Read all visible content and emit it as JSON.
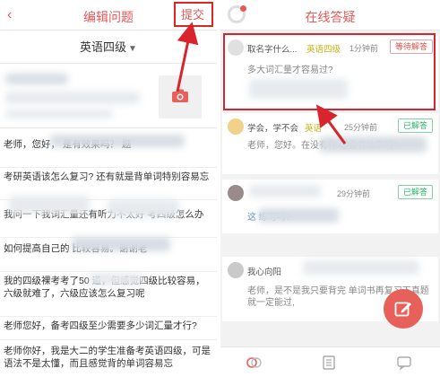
{
  "left": {
    "header": {
      "title": "编辑问题",
      "submit_label": "提交"
    },
    "subject": {
      "value": "英语四级"
    },
    "questions": [
      {
        "text": "老师，您好，     是有效果吗？   题"
      },
      {
        "text": "考研英语该怎么复习? 还有就是背单词特别容易忘"
      },
      {
        "text": "我问一下我词汇量还有听力不太好      考四级怎么办"
      },
      {
        "text": "如何提高自己的      比较容易。谢谢老"
      },
      {
        "text": "我的四级裸考考了50      道，但感觉四级比较容易，六级就难了，六级应该怎么复习呢"
      },
      {
        "text": "老师您好，备考四级至少需要多少词汇量才行?"
      },
      {
        "text": "老师你好，我是大二的学生准备考英语四级，可是语法不是太懂，而且感觉背的单词容易忘"
      }
    ]
  },
  "right": {
    "header": {
      "title": "在线答疑"
    },
    "cards": [
      {
        "user": "取名字什么...",
        "level": "英语四级",
        "time": "1分钟前",
        "status": "等待解答",
        "question": "多大词汇量才容易过?"
      },
      {
        "user": "学会，学不会",
        "level": "英语",
        "time": "25分钟前",
        "status": "已解答",
        "question": "老师，您好。在没有作      题会有效果吗?"
      },
      {
        "user": "",
        "level": "",
        "time": "29分钟前",
        "status": "已解答",
        "question": "这      练习吗?"
      },
      {
        "user": "我心向阳",
        "level": "",
        "time": "",
        "status": "",
        "question": "老师，是不是我只要背完      单词书再复习下真题就一定能过,"
      }
    ],
    "tabs": [
      "questions-tab",
      "notes-tab",
      "messages-tab"
    ]
  },
  "colors": {
    "accent": "#e05a5a",
    "annotation": "#d9232d",
    "answered": "#2db36b",
    "level": "#c7b315"
  }
}
